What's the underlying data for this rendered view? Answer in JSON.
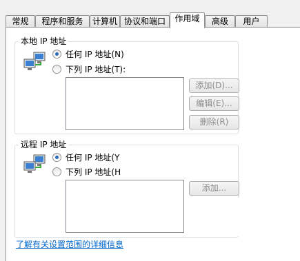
{
  "tabs": [
    {
      "label": "常规"
    },
    {
      "label": "程序和服务"
    },
    {
      "label": "计算机"
    },
    {
      "label": "协议和端口"
    },
    {
      "label": "作用域"
    },
    {
      "label": "高级"
    },
    {
      "label": "用户"
    }
  ],
  "active_tab": "作用域",
  "local_ip": {
    "group_label": "本地 IP 地址",
    "option_any": "任何 IP 地址(N)",
    "option_list": "下列 IP 地址(T):",
    "selected": "option_any",
    "add_button": "添加(D)...",
    "edit_button": "编辑(E)...",
    "delete_button": "删除(R)"
  },
  "remote_ip": {
    "group_label": "远程 IP 地址",
    "option_any": "任何 IP 地址(Y",
    "option_list": "下列 IP 地址(H",
    "selected": "option_any",
    "add_button": "添加..."
  },
  "help_link": "了解有关设置范围的详细信息",
  "colors": {
    "link": "#0066cc",
    "radio_selected": "#2a6cb7",
    "border": "#8e8f8f",
    "disabled_text": "#8d8d8d"
  },
  "icons": [
    "network-computer-icon"
  ]
}
